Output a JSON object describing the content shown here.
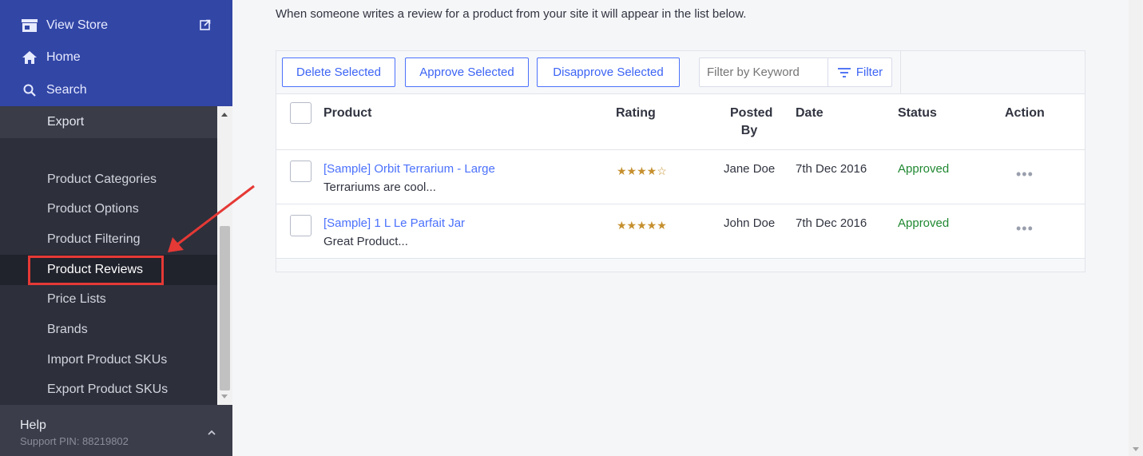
{
  "sidebar": {
    "top_items": [
      {
        "label": "View Store",
        "icon": "store-icon"
      },
      {
        "label": "Home",
        "icon": "home-icon"
      },
      {
        "label": "Search",
        "icon": "search-icon"
      }
    ],
    "export_label": "Export",
    "items": [
      {
        "label": "Product Categories"
      },
      {
        "label": "Product Options"
      },
      {
        "label": "Product Filtering"
      },
      {
        "label": "Product Reviews",
        "active": true
      },
      {
        "label": "Price Lists"
      },
      {
        "label": "Brands"
      },
      {
        "label": "Import Product SKUs"
      },
      {
        "label": "Export Product SKUs"
      }
    ],
    "help": {
      "title": "Help",
      "support_pin": "Support PIN: 88219802"
    }
  },
  "main": {
    "description": "When someone writes a review for a product from your site it will appear in the list below.",
    "toolbar": {
      "delete_label": "Delete Selected",
      "approve_label": "Approve Selected",
      "disapprove_label": "Disapprove Selected",
      "filter_placeholder": "Filter by Keyword",
      "filter_label": "Filter"
    },
    "table": {
      "headers": {
        "product": "Product",
        "rating": "Rating",
        "posted_by_1": "Posted",
        "posted_by_2": "By",
        "date": "Date",
        "status": "Status",
        "action": "Action"
      },
      "rows": [
        {
          "product": "[Sample] Orbit Terrarium - Large",
          "review": "Terrariums are cool...",
          "rating": 4,
          "stars": "★★★★☆",
          "posted_by": "Jane Doe",
          "date": "7th Dec 2016",
          "status": "Approved",
          "action": "•••"
        },
        {
          "product": "[Sample] 1 L Le Parfait Jar",
          "review": "Great Product...",
          "rating": 5,
          "stars": "★★★★★",
          "posted_by": "John Doe",
          "date": "7th Dec 2016",
          "status": "Approved",
          "action": "•••"
        }
      ]
    }
  },
  "colors": {
    "sidebar_top": "#3246a6",
    "sidebar": "#2d2f3b",
    "accent": "#4b71fc",
    "approved": "#208831",
    "star": "#c6902f",
    "annotation": "#e53935"
  }
}
